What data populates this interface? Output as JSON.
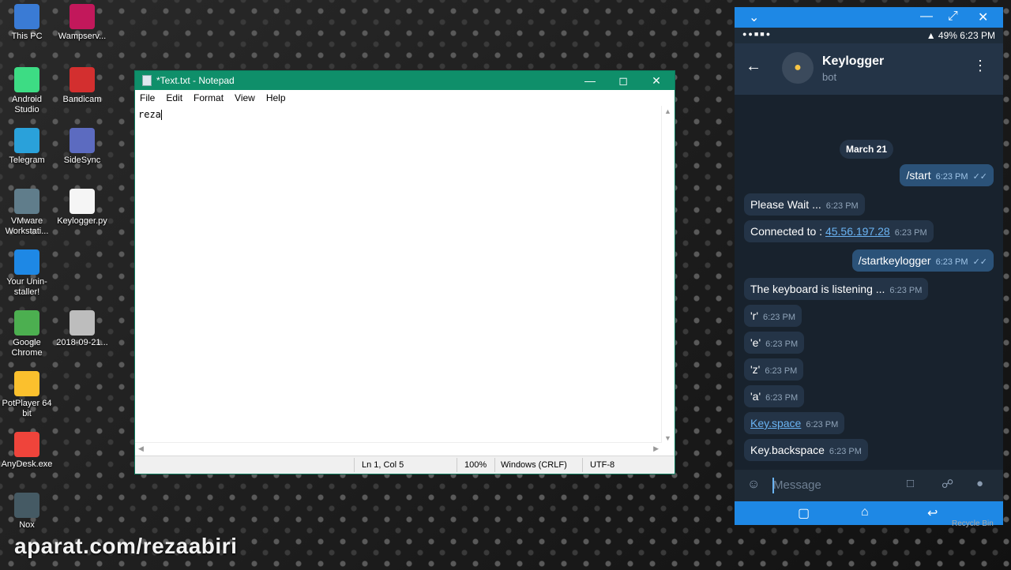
{
  "desktop": {
    "icons": [
      {
        "label": "This PC",
        "icon": "computer-icon",
        "color": "#3a7bd5"
      },
      {
        "label": "Wampserv...",
        "icon": "wamp-icon",
        "color": "#c2185b"
      },
      {
        "label": "Android Studio",
        "icon": "android-icon",
        "color": "#3ddc84"
      },
      {
        "label": "Bandicam",
        "icon": "bandicam-icon",
        "color": "#d32f2f"
      },
      {
        "label": "Telegram",
        "icon": "telegram-icon",
        "color": "#2aa1da"
      },
      {
        "label": "SideSync",
        "icon": "sidesync-icon",
        "color": "#5c6bc0"
      },
      {
        "label": "VMware Workstati...",
        "icon": "vmware-icon",
        "color": "#607d8b"
      },
      {
        "label": "Keylogger.py",
        "icon": "python-file-icon",
        "color": "#f5f5f5"
      },
      {
        "label": "Your Unin-staller!",
        "icon": "uninstaller-icon",
        "color": "#1e88e5"
      },
      {
        "label": "Google Chrome",
        "icon": "chrome-icon",
        "color": "#4caf50"
      },
      {
        "label": "2018-09-21...",
        "icon": "image-file-icon",
        "color": "#bdbdbd"
      },
      {
        "label": "PotPlayer 64 bit",
        "icon": "potplayer-icon",
        "color": "#fbc02d"
      },
      {
        "label": "AnyDesk.exe",
        "icon": "anydesk-icon",
        "color": "#ef443b"
      },
      {
        "label": "Nox",
        "icon": "nox-icon",
        "color": "#455a64"
      }
    ],
    "watermark": "aparat.com/rezaabiri",
    "recycle_label": "Recycle Bin"
  },
  "notepad": {
    "title": "*Text.txt - Notepad",
    "menu": [
      "File",
      "Edit",
      "Format",
      "View",
      "Help"
    ],
    "content": "reza",
    "status": {
      "position": "Ln 1, Col 5",
      "zoom": "100%",
      "line_ending": "Windows (CRLF)",
      "encoding": "UTF-8"
    },
    "colors": {
      "titlebar": "#0f8f6a"
    }
  },
  "phone": {
    "status_time": "6:23 PM",
    "battery": "49%",
    "chat": {
      "name": "Keylogger",
      "subtitle": "bot",
      "date": "March 21",
      "messages": [
        {
          "dir": "out",
          "text": "/start",
          "time": "6:23 PM"
        },
        {
          "dir": "in",
          "text": "Please Wait ...",
          "time": "6:23 PM"
        },
        {
          "dir": "in",
          "text": "Connected to  : ",
          "link": "45.56.197.28",
          "time": "6:23 PM"
        },
        {
          "dir": "out",
          "text": "/startkeylogger",
          "time": "6:23 PM"
        },
        {
          "dir": "in",
          "text": "The keyboard is listening ...",
          "time": "6:23 PM"
        },
        {
          "dir": "in",
          "text": "'r'",
          "time": "6:23 PM"
        },
        {
          "dir": "in",
          "text": "'e'",
          "time": "6:23 PM"
        },
        {
          "dir": "in",
          "text": "'z'",
          "time": "6:23 PM"
        },
        {
          "dir": "in",
          "text": "'a'",
          "time": "6:23 PM"
        },
        {
          "dir": "in",
          "link": "Key.space",
          "text": "",
          "time": "6:23 PM"
        },
        {
          "dir": "in",
          "text": "Key.backspace",
          "time": "6:23 PM"
        }
      ],
      "input_placeholder": "Message"
    },
    "colors": {
      "frame": "#1e88e5",
      "header": "#243447",
      "chat_bg": "#18222d",
      "bubble_in": "#243447",
      "bubble_out": "#2b5278"
    }
  }
}
